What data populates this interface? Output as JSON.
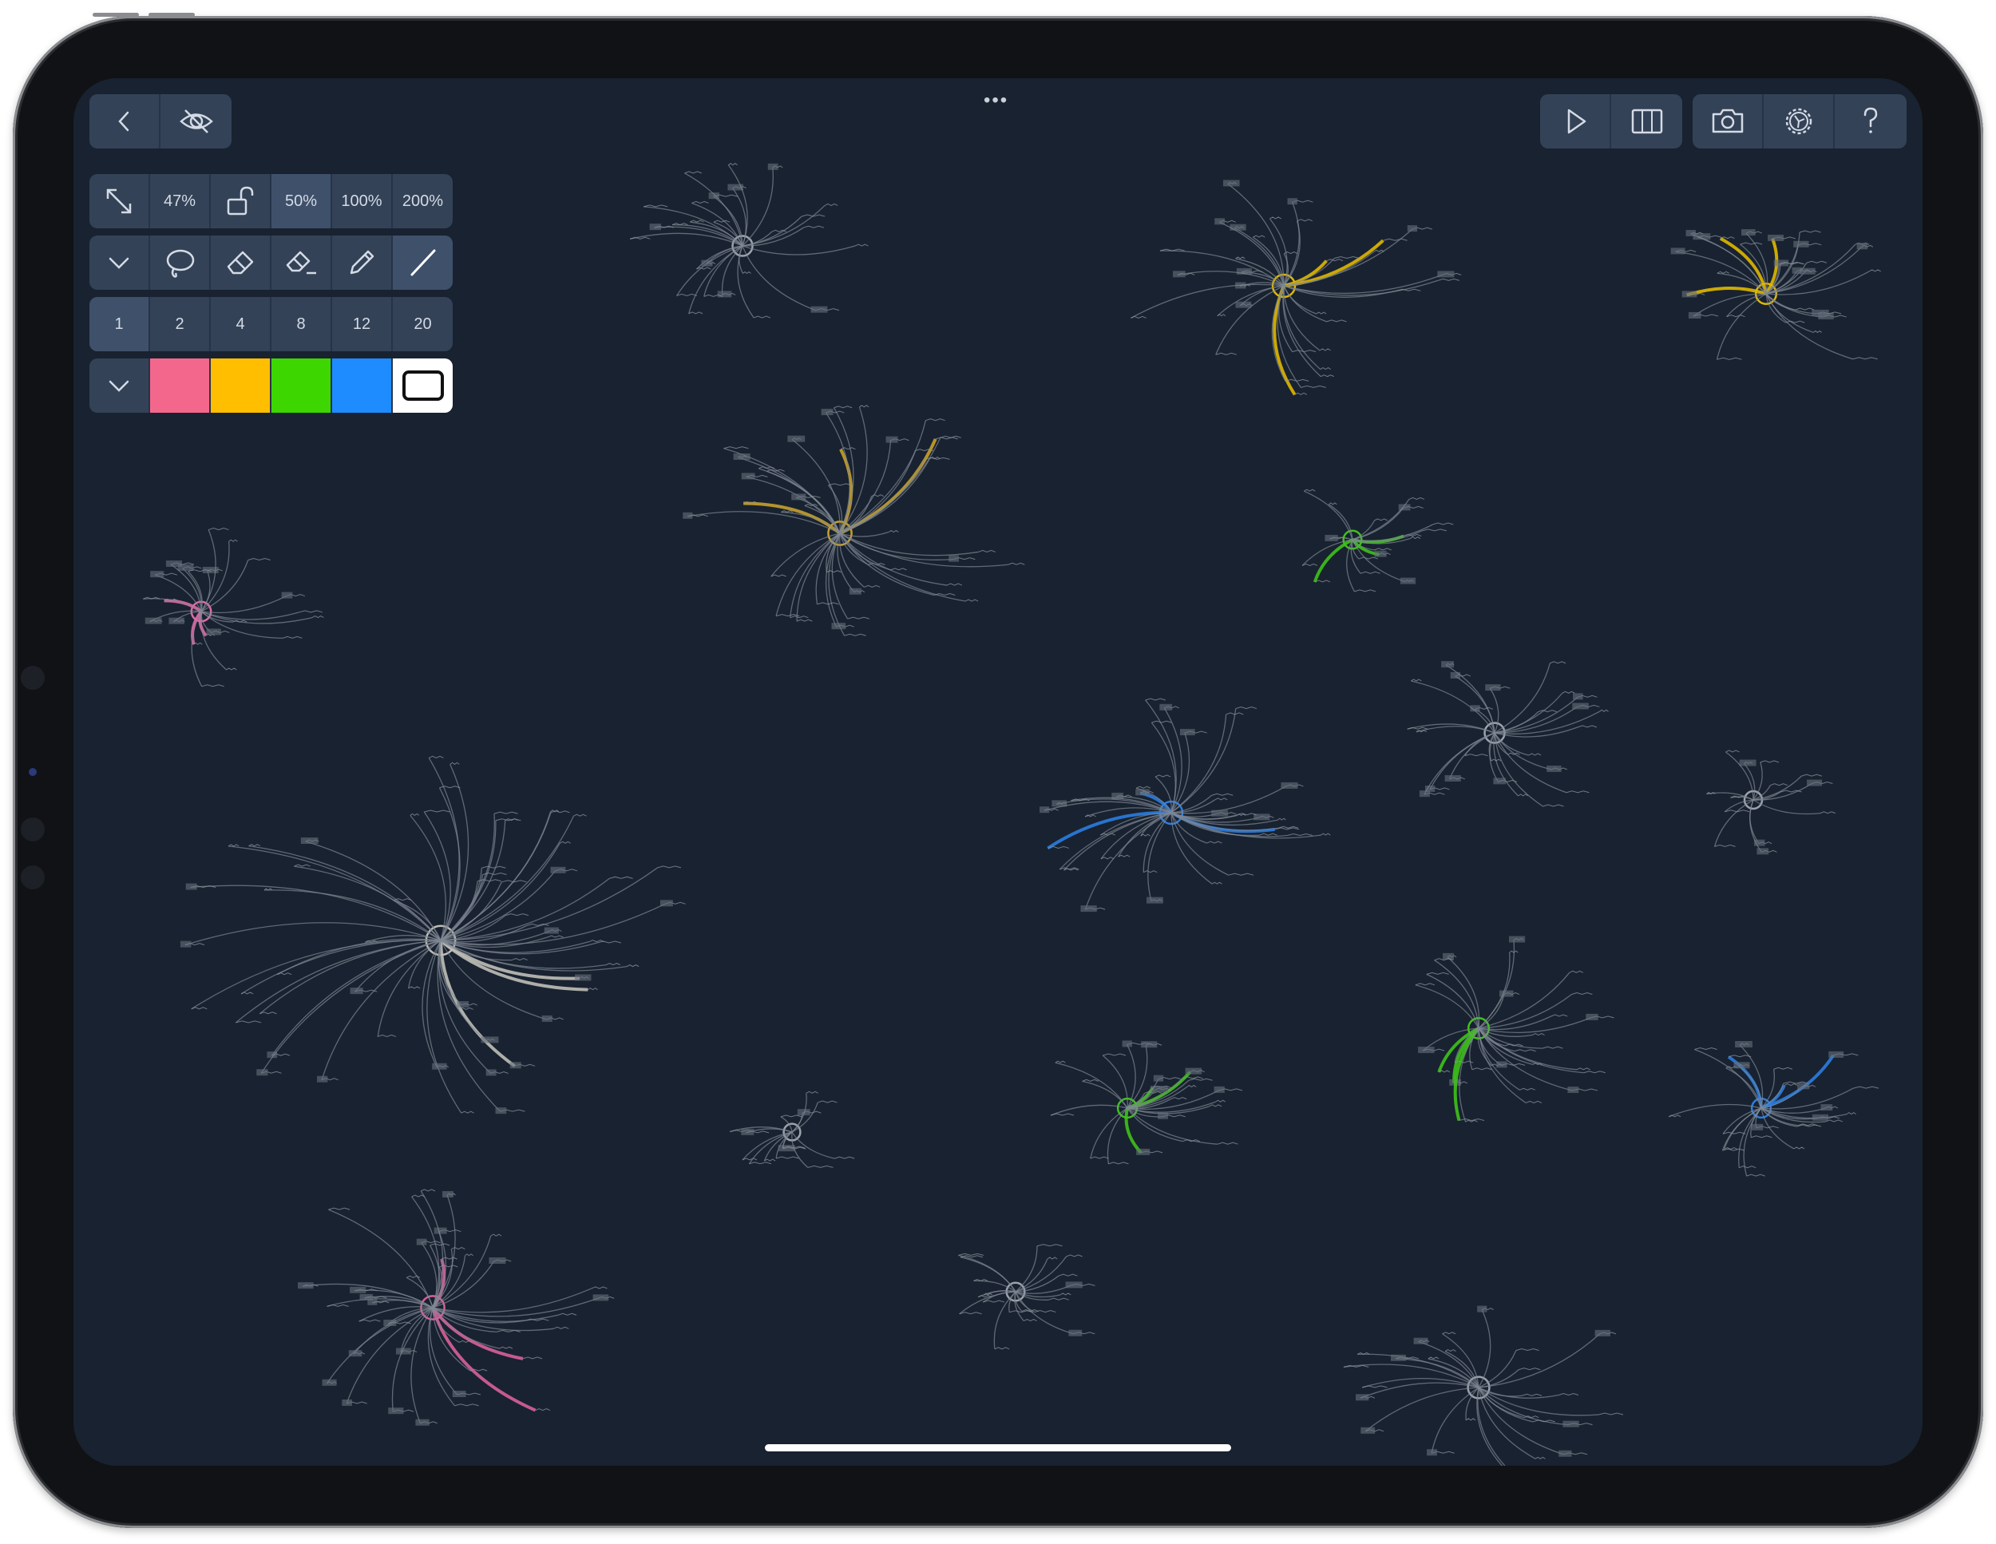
{
  "app": {
    "name": "mind map canvas"
  },
  "top_left": [
    {
      "name": "back-button",
      "icon": "chevron-left-icon"
    },
    {
      "name": "visibility-toggle-button",
      "icon": "eye-off-icon"
    }
  ],
  "top_right": [
    {
      "name": "present-button",
      "icon": "play-icon"
    },
    {
      "name": "columns-view-button",
      "icon": "columns-icon"
    },
    {
      "name": "snapshot-button",
      "icon": "camera-icon"
    },
    {
      "name": "settings-button",
      "icon": "gear-icon"
    },
    {
      "name": "help-button",
      "icon": "question-icon"
    }
  ],
  "more_indicator": "•••",
  "zoom_row": {
    "fit_icon": "expand-arrows-icon",
    "current": "47%",
    "lock_icon": "unlock-icon",
    "presets": [
      "50%",
      "100%",
      "200%"
    ]
  },
  "tools_row": {
    "collapse_icon": "chevron-down-icon",
    "tools": [
      "lasso-icon",
      "eraser-icon",
      "stroke-eraser-icon",
      "pencil-icon",
      "line-icon"
    ],
    "selected": "line-icon"
  },
  "widths_row": {
    "values": [
      "1",
      "2",
      "4",
      "8",
      "12",
      "20"
    ],
    "selected": "1"
  },
  "colors_row": {
    "collapse_icon": "chevron-down-icon",
    "colors": [
      "#f4678c",
      "#ffbf00",
      "#3ed600",
      "#1e8cff",
      "#ffffff"
    ],
    "selected": "#ffffff"
  }
}
